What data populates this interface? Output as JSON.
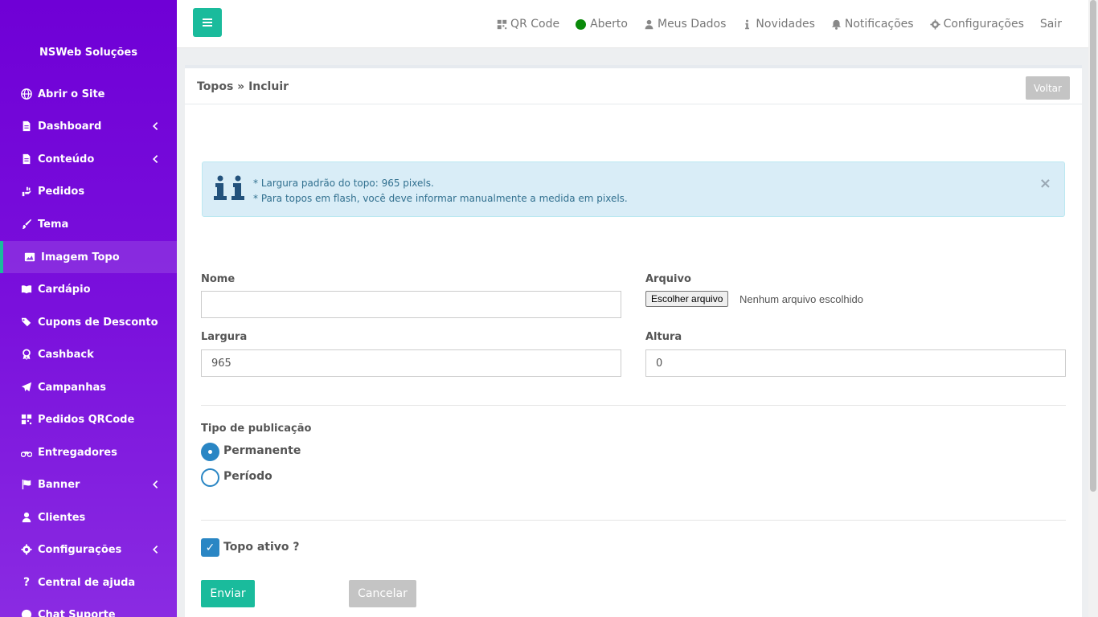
{
  "sidebar": {
    "brand": "NSWeb Soluções",
    "items": [
      {
        "label": "Abrir o Site",
        "icon": "globe-icon"
      },
      {
        "label": "Dashboard",
        "icon": "document-icon",
        "has_submenu": true
      },
      {
        "label": "Conteúdo",
        "icon": "document-icon",
        "has_submenu": true
      },
      {
        "label": "Pedidos",
        "icon": "hand-icon"
      },
      {
        "label": "Tema",
        "icon": "brush-icon"
      },
      {
        "label": "Imagem Topo",
        "icon": "image-icon",
        "active": true
      },
      {
        "label": "Cardápio",
        "icon": "book-icon"
      },
      {
        "label": "Cupons de Desconto",
        "icon": "tags-icon"
      },
      {
        "label": "Cashback",
        "icon": "award-icon"
      },
      {
        "label": "Campanhas",
        "icon": "paper-plane-icon"
      },
      {
        "label": "Pedidos QRCode",
        "icon": "qrcode-icon"
      },
      {
        "label": "Entregadores",
        "icon": "motorcycle-icon"
      },
      {
        "label": "Banner",
        "icon": "flag-icon",
        "has_submenu": true
      },
      {
        "label": "Clientes",
        "icon": "user-icon"
      },
      {
        "label": "Configurações",
        "icon": "gear-icon",
        "has_submenu": true
      },
      {
        "label": "Central de ajuda",
        "icon": "question-icon"
      },
      {
        "label": "Chat Suporte",
        "icon": "chat-icon"
      }
    ]
  },
  "topbar": {
    "qr_code": "QR Code",
    "status": "Aberto",
    "status_color": "#0a8a0a",
    "my_data": "Meus Dados",
    "news": "Novidades",
    "notifications": "Notificações",
    "settings": "Configurações",
    "logout": "Sair"
  },
  "panel": {
    "breadcrumb": "Topos » Incluir",
    "back_label": "Voltar"
  },
  "alert": {
    "line1": "* Largura padrão do topo: 965 pixels.",
    "line2": "* Para topos em flash, você deve informar manualmente a medida em pixels.",
    "close": "×"
  },
  "form": {
    "name_label": "Nome",
    "name_value": "",
    "file_label": "Arquivo",
    "file_button": "Escolher arquivo",
    "file_status": "Nenhum arquivo escolhido",
    "width_label": "Largura",
    "width_value": "965",
    "height_label": "Altura",
    "height_value": "0",
    "pub_type_label": "Tipo de publicação",
    "pub_permanent": "Permanente",
    "pub_period": "Período",
    "active_label": "Topo ativo ?",
    "submit": "Enviar",
    "cancel": "Cancelar"
  },
  "colors": {
    "accent": "#1abb9c",
    "sidebar_top": "#6f00d6",
    "radio_blue": "#2a86c4"
  }
}
